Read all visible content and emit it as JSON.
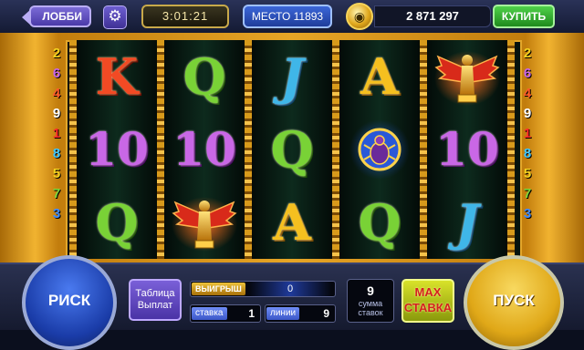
{
  "topbar": {
    "lobby_label": "ЛОББИ",
    "gear_icon": "gear-icon",
    "timer": "3:01:21",
    "place_label": "МЕСТО 11893",
    "coin_icon": "coin-icon",
    "balance": "2 871 297",
    "buy_label": "КУПИТЬ"
  },
  "paylines": {
    "left": [
      "2",
      "6",
      "4",
      "9",
      "1",
      "8",
      "5",
      "7",
      "3"
    ],
    "right": [
      "2",
      "6",
      "4",
      "9",
      "1",
      "8",
      "5",
      "7",
      "3"
    ],
    "colors": [
      "#f5d21f",
      "#c967e6",
      "#ff5a2a",
      "#ffffff",
      "#ff2a2a",
      "#40c8ff",
      "#f5d21f",
      "#7cd63a",
      "#3f8cff"
    ]
  },
  "reels": [
    [
      {
        "type": "letter",
        "text": "K",
        "cls": "k"
      },
      {
        "type": "letter",
        "text": "10",
        "cls": "ten"
      },
      {
        "type": "letter",
        "text": "Q",
        "cls": "q"
      }
    ],
    [
      {
        "type": "letter",
        "text": "Q",
        "cls": "q"
      },
      {
        "type": "letter",
        "text": "10",
        "cls": "ten"
      },
      {
        "type": "icon",
        "icon": "winged-goddess-icon"
      }
    ],
    [
      {
        "type": "letter",
        "text": "J",
        "cls": "j"
      },
      {
        "type": "letter",
        "text": "Q",
        "cls": "q"
      },
      {
        "type": "letter",
        "text": "A",
        "cls": "a"
      }
    ],
    [
      {
        "type": "letter",
        "text": "A",
        "cls": "a"
      },
      {
        "type": "icon",
        "icon": "scarab-icon"
      },
      {
        "type": "letter",
        "text": "Q",
        "cls": "q"
      }
    ],
    [
      {
        "type": "icon",
        "icon": "winged-goddess-icon"
      },
      {
        "type": "letter",
        "text": "10",
        "cls": "ten"
      },
      {
        "type": "letter",
        "text": "J",
        "cls": "j"
      }
    ]
  ],
  "bottom": {
    "risk_label": "РИСК",
    "paytable_label": "Таблица Выплат",
    "win_label": "ВЫИГРЫШ",
    "win_value": "0",
    "bet_label": "ставка",
    "bet_value": "1",
    "lines_label": "линии",
    "lines_value": "9",
    "total_value": "9",
    "total_label": "сумма ставок",
    "max_line1": "MAX",
    "max_line2": "СТАВКА",
    "spin_label": "ПУСК"
  }
}
